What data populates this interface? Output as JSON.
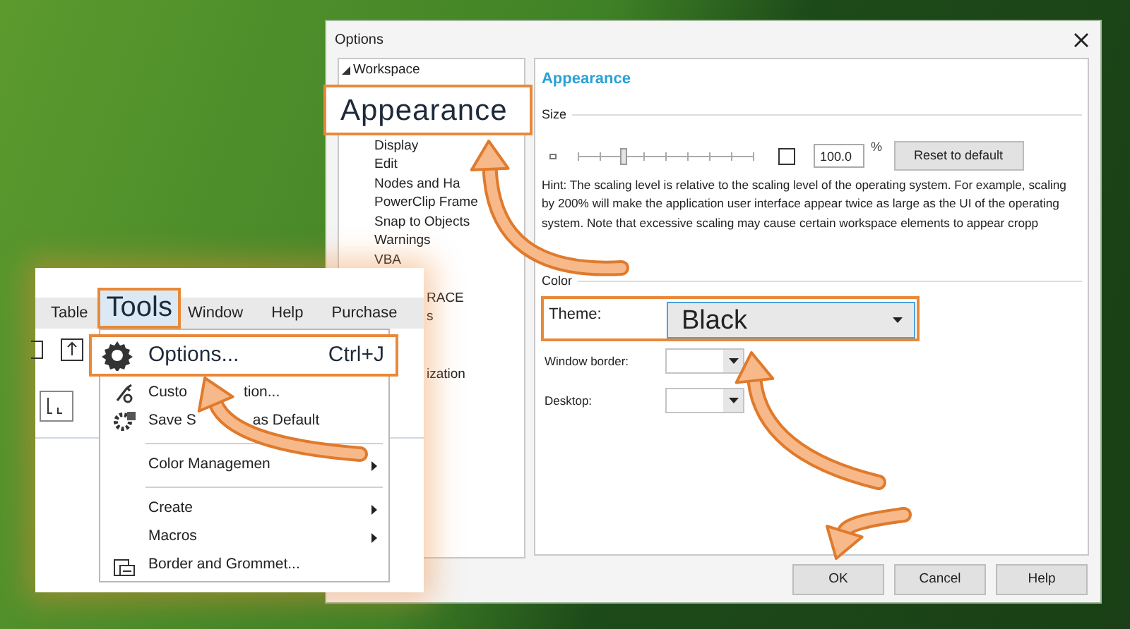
{
  "dialog": {
    "title": "Options",
    "tree": {
      "label": "Workspace",
      "expanded": true,
      "children": [
        {
          "label": "Appearance",
          "selected": true,
          "kind": "item"
        },
        {
          "label": "Display",
          "selected": false,
          "kind": "item"
        },
        {
          "label": "Edit",
          "selected": false,
          "kind": "item"
        },
        {
          "label": "Nodes and Ha",
          "selected": false,
          "kind": "item"
        },
        {
          "label": "PowerClip Frame",
          "selected": false,
          "kind": "item"
        },
        {
          "label": "Snap to Objects",
          "selected": false,
          "kind": "item"
        },
        {
          "label": "Warnings",
          "selected": false,
          "kind": "item"
        },
        {
          "label": "VBA",
          "selected": false,
          "kind": "item"
        },
        {
          "label": "RACE",
          "selected": false,
          "kind": "clipped"
        },
        {
          "label": "s",
          "selected": false,
          "kind": "clipped"
        },
        {
          "label": "ization",
          "selected": false,
          "kind": "clipped"
        }
      ]
    },
    "page": {
      "heading": "Appearance",
      "size": {
        "label": "Size",
        "slider": {
          "level": 0.25
        },
        "checked": false,
        "value": "100.0",
        "unit": "%",
        "reset_button": "Reset to default",
        "hint": "Hint: The scaling level is relative to the scaling level of the operating system. For example, scaling by 200% will make the application user interface appear twice as large as the UI of the operating system. Note that excessive scaling may cause certain workspace elements to appear cropp"
      },
      "color": {
        "label": "Color",
        "fields": [
          {
            "label": "Theme:",
            "value": "Black",
            "kind": "highlighted"
          },
          {
            "label": "Window border:",
            "kind": "small"
          },
          {
            "label": "Desktop:",
            "kind": "small"
          }
        ]
      }
    },
    "buttons": [
      "OK",
      "Cancel",
      "Help"
    ]
  },
  "tools_inset": {
    "menu_bar": [
      {
        "label": "Table",
        "selected": false
      },
      {
        "label": "Tools",
        "selected": true
      },
      {
        "label": "Window",
        "selected": false
      },
      {
        "label": "Help",
        "selected": false
      },
      {
        "label": "Purchase",
        "selected": false
      }
    ],
    "menu": [
      {
        "kind": "item",
        "label": "Options...",
        "shortcut": "Ctrl+J",
        "selected": true
      },
      {
        "kind": "item",
        "label": "Custo",
        "label_end": "tion...",
        "selected": false
      },
      {
        "kind": "item",
        "label": "Save S",
        "label_end": "as Default",
        "selected": false
      },
      {
        "kind": "separator"
      },
      {
        "kind": "item",
        "label": "Color Managemen",
        "submenu": true,
        "selected": false
      },
      {
        "kind": "separator"
      },
      {
        "kind": "item",
        "label": "Create",
        "submenu": true,
        "selected": false
      },
      {
        "kind": "item",
        "label": "Macros",
        "submenu": true,
        "selected": false
      },
      {
        "kind": "item",
        "label": "Border and Grommet...",
        "selected": false
      }
    ]
  }
}
